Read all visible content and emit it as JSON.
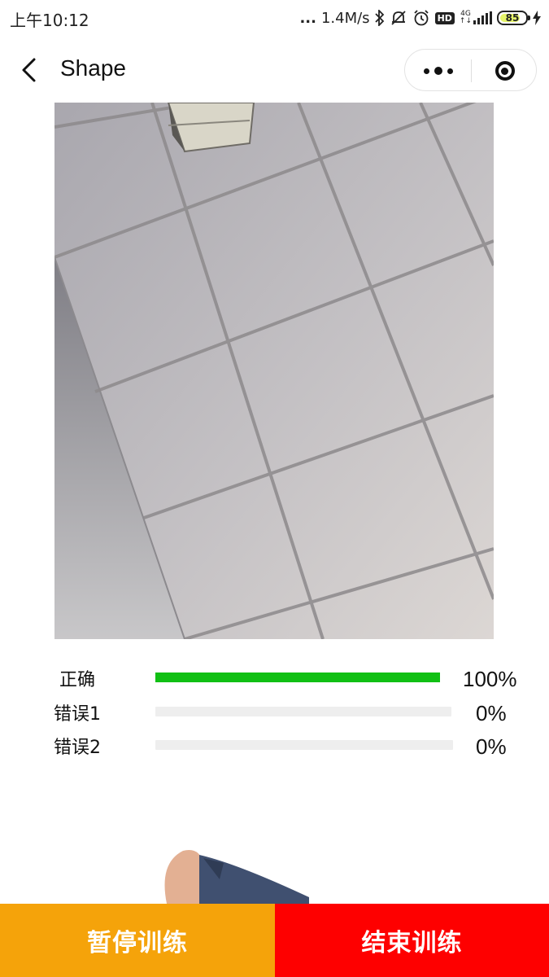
{
  "status_bar": {
    "time": "上午10:12",
    "dots": "...",
    "net_speed": "1.4M/s",
    "hd": "HD",
    "net_type": "4G",
    "battery": "85",
    "icons": [
      "bluetooth-icon",
      "mute-icon",
      "alarm-icon",
      "signal-icon",
      "battery-icon",
      "charging-icon"
    ]
  },
  "nav": {
    "title": "Shape",
    "icons": [
      "back-icon",
      "more-icon",
      "close-mini-program-icon"
    ]
  },
  "results": [
    {
      "label": "正确",
      "percent_text": "100%",
      "value": 1.0
    },
    {
      "label": "错误1",
      "percent_text": "0%",
      "value": 0.0
    },
    {
      "label": "错误2",
      "percent_text": "0%",
      "value": 0.0
    }
  ],
  "buttons": {
    "pause": "暂停训练",
    "end": "结束训练"
  },
  "colors": {
    "progress": "#11c014",
    "track": "#eeeeee",
    "pause": "#f5a30a",
    "end": "#fe0000"
  }
}
